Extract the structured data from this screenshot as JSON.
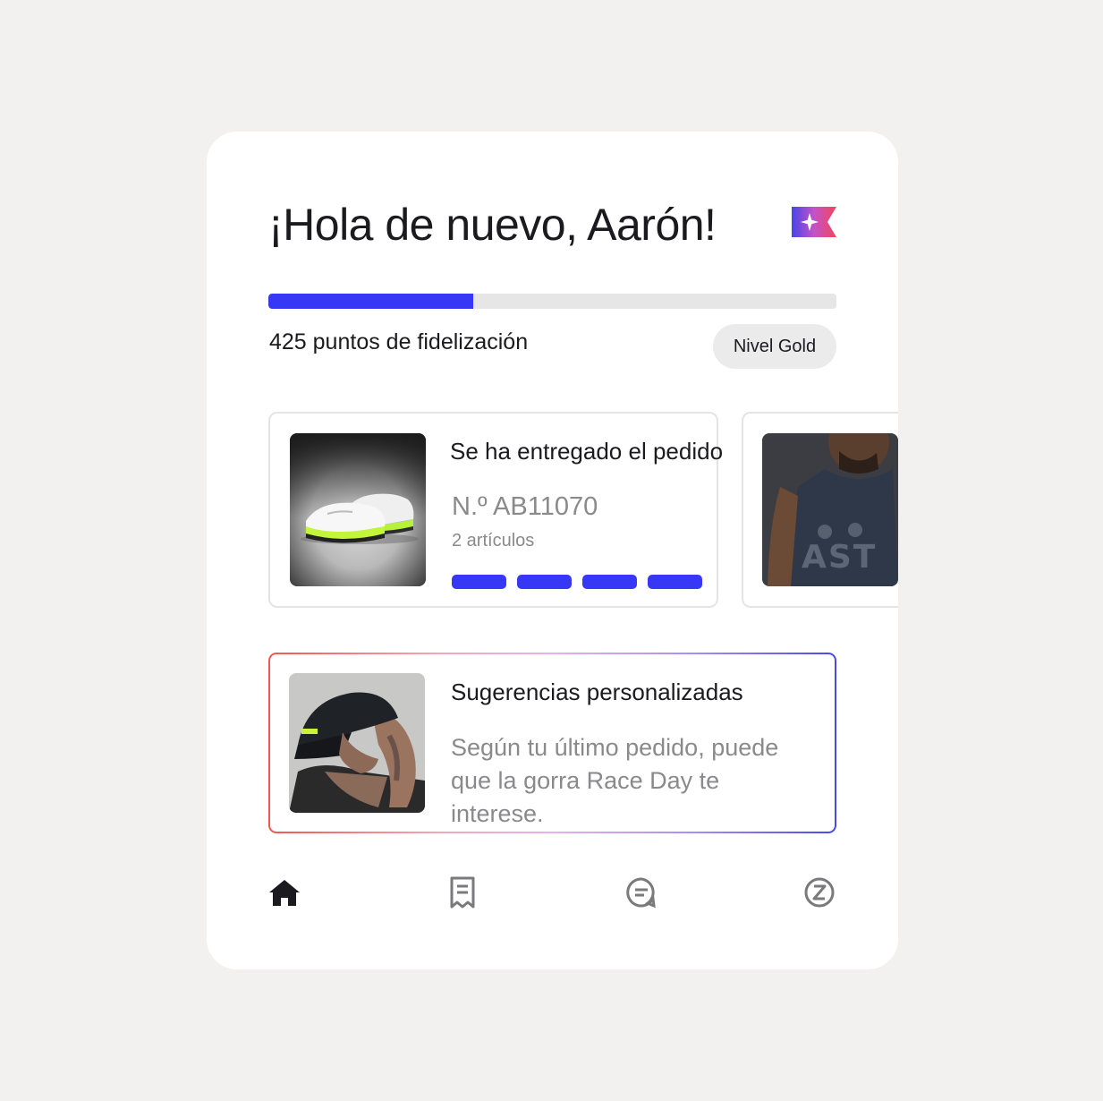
{
  "header": {
    "greeting": "¡Hola de nuevo, Aarón!",
    "flag_icon": "sparkle-flag-icon"
  },
  "loyalty": {
    "points_text": "425 puntos de fidelización",
    "tier": "Nivel Gold",
    "progress_fraction": 0.36,
    "progress_color": "#3738f5"
  },
  "order": {
    "title": "Se ha entregado el pedido",
    "number": "N.º AB11070",
    "items": "2 artículos",
    "steps_completed": 4,
    "steps_total": 4,
    "image": "running-shoe-photo"
  },
  "next_card": {
    "image": "athlete-shirt-photo"
  },
  "suggestion": {
    "title": "Sugerencias personalizadas",
    "body": "Según tu último pedido, puede que la gorra Race Day te interese.",
    "image": "man-with-cap-photo",
    "border_gradient": [
      "#f0584b",
      "#e9b0ee",
      "#4a47e6"
    ]
  },
  "nav": {
    "items": [
      {
        "icon": "home-icon",
        "active": true
      },
      {
        "icon": "receipt-icon",
        "active": false
      },
      {
        "icon": "chat-icon",
        "active": false
      },
      {
        "icon": "profile-z-icon",
        "active": false
      }
    ]
  },
  "colors": {
    "accent": "#3738f5",
    "background": "#f2f1ef",
    "muted_text": "#8a8a8c"
  }
}
